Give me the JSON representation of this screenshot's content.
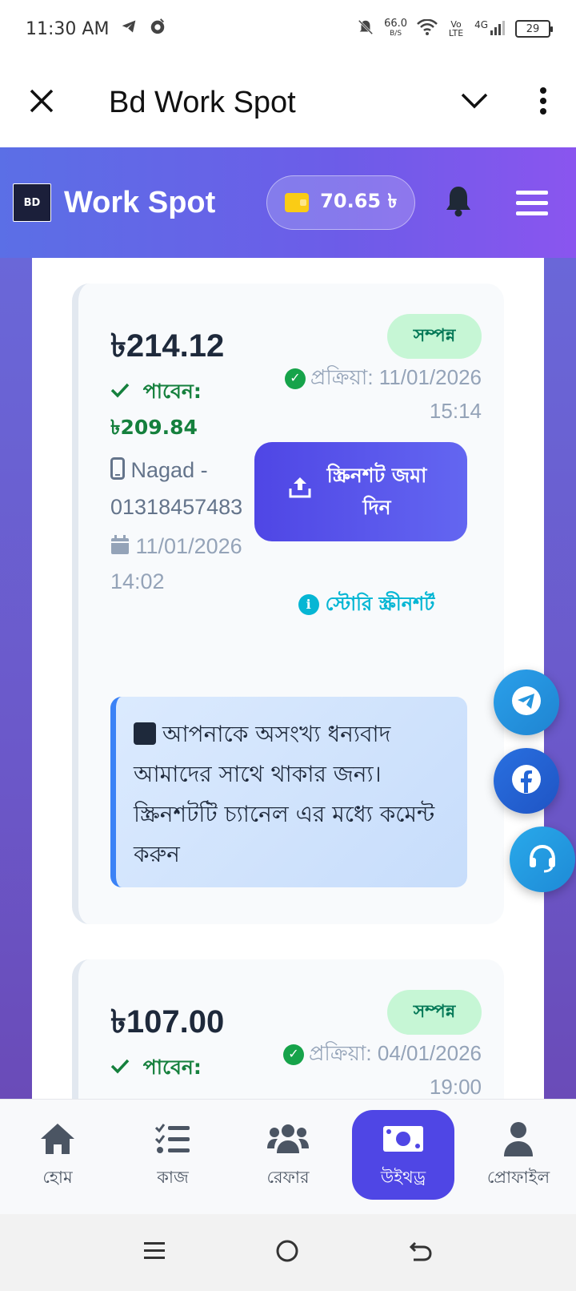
{
  "status_bar": {
    "time": "11:30 AM",
    "net_speed": "66.0",
    "net_unit": "B/S",
    "volte": "Vo LTE",
    "network": "4G",
    "battery": "29"
  },
  "app_header": {
    "title": "Bd Work Spot"
  },
  "site_nav": {
    "logo_text": "BD",
    "brand": "Work Spot",
    "balance": "70.65 ৳"
  },
  "withdrawals": [
    {
      "amount": "৳214.12",
      "status": "সম্পন্ন",
      "receive_label": "পাবেন:",
      "receive_amount": "৳209.84",
      "method": "Nagad - 01318457483",
      "date": "11/01/2026 14:02",
      "processed_label": "প্রক্রিয়া: 11/01/2026",
      "processed_time": "15:14",
      "upload_button": "স্ক্রিনশট জমা দিন",
      "story_link": "স্টোরি স্ক্রীনশর্ট",
      "note": "আপনাকে অসংখ্য ধন্যবাদ আমাদের সাথে থাকার জন্য। স্ক্রিনশটটি চ্যানেল এর মধ্যে কমেন্ট করুন"
    },
    {
      "amount": "৳107.00",
      "status": "সম্পন্ন",
      "receive_label": "পাবেন:",
      "processed_label": "প্রক্রিয়া: 04/01/2026",
      "processed_time": "19:00"
    }
  ],
  "bottom_nav": {
    "items": [
      {
        "label": "হোম",
        "icon": "home-icon"
      },
      {
        "label": "কাজ",
        "icon": "tasks-icon"
      },
      {
        "label": "রেফার",
        "icon": "users-icon"
      },
      {
        "label": "উইথড্র",
        "icon": "money-icon"
      },
      {
        "label": "প্রোফাইল",
        "icon": "user-icon"
      }
    ],
    "active_index": 3
  },
  "colors": {
    "primary": "#4f46e5",
    "success": "#15803d",
    "badge_bg": "#c6f6d5",
    "accent_cyan": "#06b6d4"
  }
}
